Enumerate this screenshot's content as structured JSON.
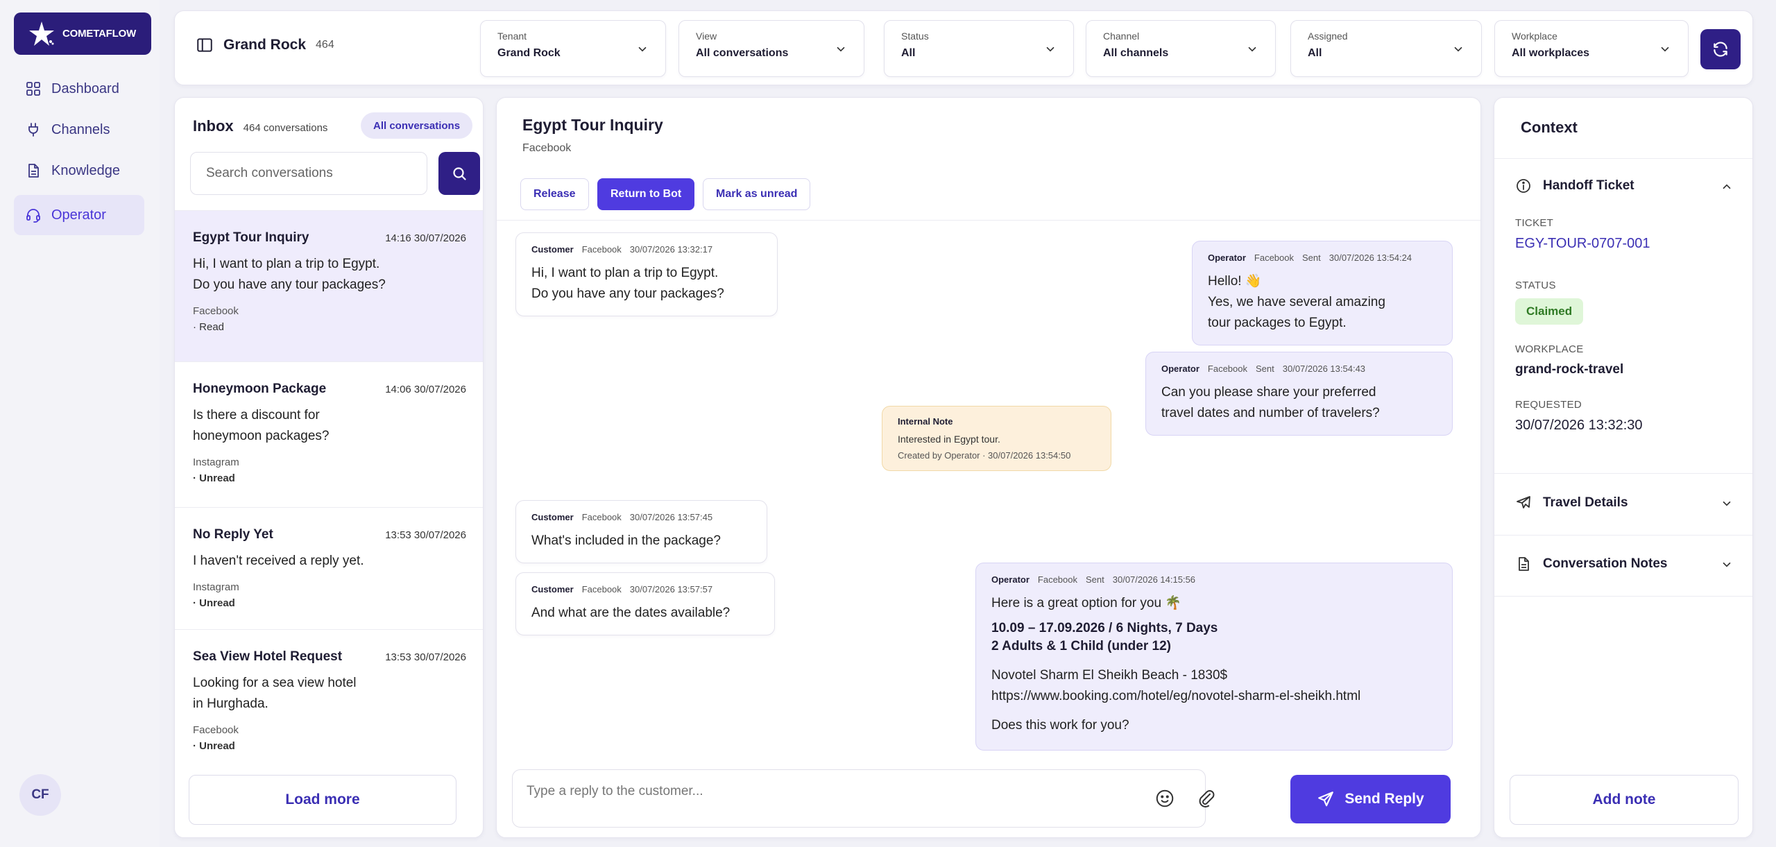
{
  "app": {
    "logo_text": "COMETAFLOW",
    "avatar_initials": "CF"
  },
  "sidebar": {
    "items": [
      {
        "label": "Dashboard",
        "icon": "grid-icon"
      },
      {
        "label": "Channels",
        "icon": "plug-icon"
      },
      {
        "label": "Knowledge",
        "icon": "document-icon"
      },
      {
        "label": "Operator",
        "icon": "headset-icon",
        "active": true
      }
    ]
  },
  "header": {
    "tenant_name": "Grand Rock",
    "tenant_count": "464",
    "filters": [
      {
        "label": "Tenant",
        "value": "Grand Rock"
      },
      {
        "label": "View",
        "value": "All conversations"
      },
      {
        "label": "Status",
        "value": "All"
      },
      {
        "label": "Channel",
        "value": "All channels"
      },
      {
        "label": "Assigned",
        "value": "All"
      },
      {
        "label": "Workplace",
        "value": "All workplaces"
      }
    ]
  },
  "inbox": {
    "title": "Inbox",
    "count_label": "464 conversations",
    "view_pill": "All conversations",
    "search_placeholder": "Search conversations",
    "load_more": "Load more",
    "conversations": [
      {
        "title": "Egypt Tour Inquiry",
        "time": "14:16 30/07/2026",
        "preview": "Hi, I want to plan a trip to Egypt.\nDo you have any tour packages?",
        "channel": "Facebook",
        "status": "· Read",
        "selected": true
      },
      {
        "title": "Honeymoon Package",
        "time": "14:06 30/07/2026",
        "preview": "Is there a discount for\nhoneymoon packages?",
        "channel": "Instagram",
        "status": "· Unread"
      },
      {
        "title": "No Reply Yet",
        "time": "13:53 30/07/2026",
        "preview": "I haven't received a reply yet.",
        "channel": "Instagram",
        "status": "· Unread"
      },
      {
        "title": "Sea View Hotel Request",
        "time": "13:53 30/07/2026",
        "preview": "Looking for a sea view hotel\nin Hurghada.",
        "channel": "Facebook",
        "status": "· Unread"
      }
    ]
  },
  "chat": {
    "title": "Egypt Tour Inquiry",
    "channel": "Facebook",
    "actions": {
      "release": "Release",
      "return_to_bot": "Return to Bot",
      "mark_unread": "Mark as unread"
    },
    "messages": {
      "m1": {
        "role": "Customer",
        "channel": "Facebook",
        "time": "30/07/2026 13:32:17",
        "text": "Hi, I want to plan a trip to Egypt.\nDo you have any tour packages?"
      },
      "m2": {
        "role": "Operator",
        "channel": "Facebook",
        "sent": "Sent",
        "time": "30/07/2026 13:54:24",
        "text": "Hello! 👋\nYes, we have several amazing\ntour packages to Egypt."
      },
      "m3": {
        "role": "Operator",
        "channel": "Facebook",
        "sent": "Sent",
        "time": "30/07/2026 13:54:43",
        "text": "Can you please share your preferred\ntravel dates and number of travelers?"
      },
      "note": {
        "title": "Internal Note",
        "text": "Interested in Egypt tour.",
        "created": "Created by Operator · 30/07/2026 13:54:50"
      },
      "m4": {
        "role": "Customer",
        "channel": "Facebook",
        "time": "30/07/2026 13:57:45",
        "text": "What's included in the package?"
      },
      "m5": {
        "role": "Customer",
        "channel": "Facebook",
        "time": "30/07/2026 13:57:57",
        "text": "And what are the dates available?"
      },
      "m6": {
        "role": "Operator",
        "channel": "Facebook",
        "sent": "Sent",
        "time": "30/07/2026 14:15:56",
        "intro": "Here is a great option for you 🌴",
        "dates": "10.09 – 17.09.2026 / 6 Nights, 7 Days",
        "guests": "2 Adults & 1 Child (under 12)",
        "hotel": "Novotel Sharm El Sheikh Beach - 1830$",
        "link": "https://www.booking.com/hotel/eg/novotel-sharm-el-sheikh.html",
        "question": "Does this work for you?"
      }
    },
    "reply_placeholder": "Type a reply to the customer...",
    "send_label": "Send Reply"
  },
  "context": {
    "title": "Context",
    "handoff": {
      "title": "Handoff Ticket",
      "ticket_label": "TICKET",
      "ticket_value": "EGY-TOUR-0707-001",
      "status_label": "STATUS",
      "status_value": "Claimed",
      "workplace_label": "WORKPLACE",
      "workplace_value": "grand-rock-travel",
      "requested_label": "REQUESTED",
      "requested_value": "30/07/2026 13:32:30"
    },
    "travel_details": "Travel Details",
    "conversation_notes": "Conversation Notes",
    "add_note": "Add note"
  },
  "colors": {
    "accent": "#4f3be0",
    "brand_dark": "#2b1d7a",
    "claimed_bg": "#dff6d8",
    "note_bg": "#fdf0dc"
  }
}
